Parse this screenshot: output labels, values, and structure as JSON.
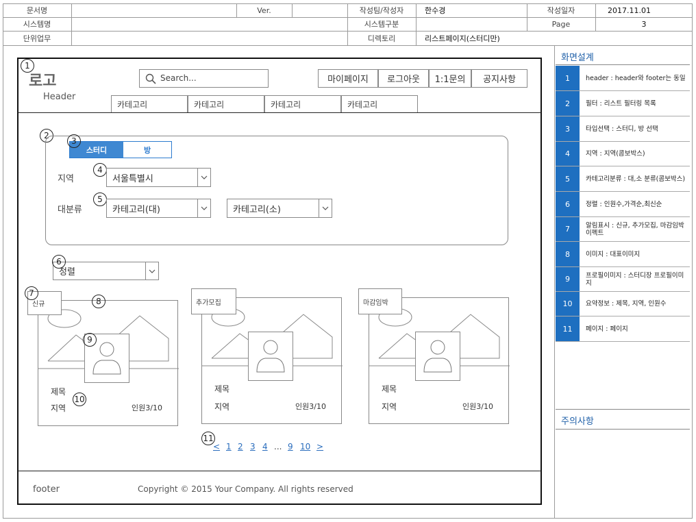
{
  "doc_header": {
    "doc_name_label": "문서명",
    "ver_label": "Ver.",
    "team_label": "작성팀/작성자",
    "team_value": "한수경",
    "date_label": "작성일자",
    "date_value": "2017.11.01",
    "system_name_label": "시스템명",
    "system_div_label": "시스템구분",
    "page_label": "Page",
    "page_value": "3",
    "unit_label": "단위업무",
    "dir_label": "디렉토리",
    "dir_value": "리스트페이지(스터디만)"
  },
  "wireframe": {
    "logo": "로고",
    "header_caption": "Header",
    "search_placeholder": "Search...",
    "nav_buttons": [
      "마이페이지",
      "로그아웃",
      "1:1문의",
      "공지사항"
    ],
    "categories": [
      "카테고리",
      "카테고리",
      "카테고리",
      "카테고리"
    ],
    "type_tabs": {
      "active": "스터디",
      "inactive": "방"
    },
    "region_label": "지역",
    "region_value": "서울특별시",
    "category_label": "대분류",
    "cat_big_value": "카테고리(대)",
    "cat_small_value": "카테고리(소)",
    "sort_value": "정렬",
    "cards": [
      {
        "badge": "신규",
        "title": "제목",
        "region": "지역",
        "count": "인원3/10"
      },
      {
        "badge": "추가모집",
        "title": "제목",
        "region": "지역",
        "count": "인원3/10"
      },
      {
        "badge": "마감임박",
        "title": "제목",
        "region": "지역",
        "count": "인원3/10"
      }
    ],
    "pagination": [
      "<",
      "1",
      "2",
      "3",
      "4",
      "...",
      "9",
      "10",
      ">"
    ],
    "footer_label": "footer",
    "copyright": "Copyright © 2015 Your Company. All rights reserved",
    "markers": [
      "1",
      "2",
      "3",
      "4",
      "5",
      "6",
      "7",
      "8",
      "9",
      "10",
      "11"
    ]
  },
  "sidebar": {
    "title": "화면설계",
    "notes_title": "주의사항",
    "items": [
      {
        "num": "1",
        "text": "header : header와 footer는 동일"
      },
      {
        "num": "2",
        "text": "필터 : 리스트 필터링 목록"
      },
      {
        "num": "3",
        "text": "타입선택 : 스터디, 방 선택"
      },
      {
        "num": "4",
        "text": "지역 : 지역(콤보박스)"
      },
      {
        "num": "5",
        "text": "카테고리분류  : 대,소 분류(콤보박스)"
      },
      {
        "num": "6",
        "text": "정렬 : 인원수,가격순,최신순"
      },
      {
        "num": "7",
        "text": "알림표시 : 신규, 추가모집, 마감임박 이펙트"
      },
      {
        "num": "8",
        "text": "이미지 : 대표이미지"
      },
      {
        "num": "9",
        "text": "프로필이미지 : 스터디장 프로필이미지"
      },
      {
        "num": "10",
        "text": "요약정보 : 제목, 지역, 인원수"
      },
      {
        "num": "11",
        "text": "페이지 : 페이지"
      }
    ]
  }
}
